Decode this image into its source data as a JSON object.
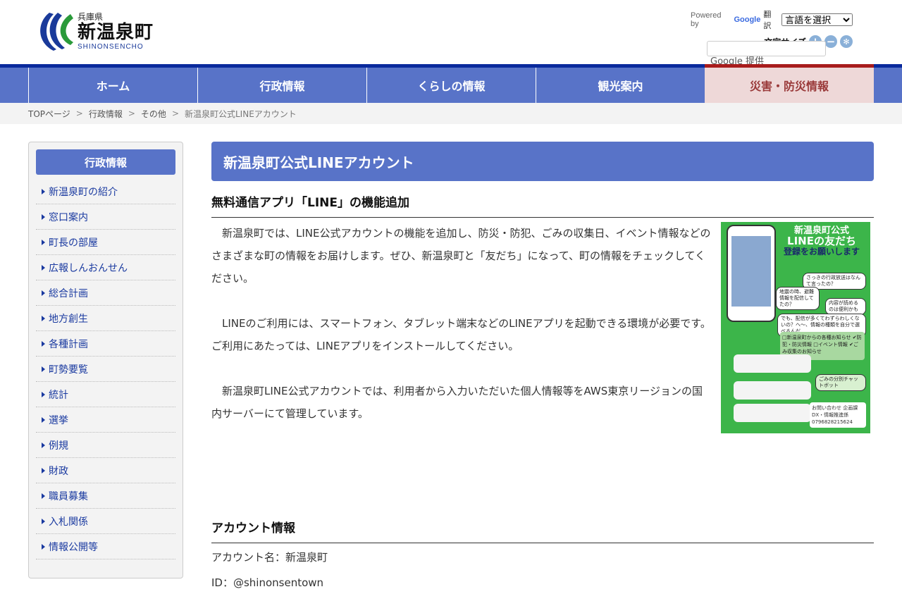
{
  "header": {
    "prefecture": "兵庫県",
    "town": "新温泉町",
    "romaji": "SHINONSENCHO",
    "powered_by": "Powered by",
    "google": "Google",
    "translate": "翻訳",
    "language_select": "言語を選択",
    "font_size_label": "文字サイズ",
    "google_provided": "Google 提供"
  },
  "nav": [
    "ホーム",
    "行政情報",
    "くらしの情報",
    "観光案内",
    "災害・防災情報"
  ],
  "breadcrumb": [
    "TOPページ",
    "行政情報",
    "その他",
    "新温泉町公式LINEアカウント"
  ],
  "breadcrumb_sep": ">",
  "sidebar": {
    "title": "行政情報",
    "items": [
      "新温泉町の紹介",
      "窓口案内",
      "町長の部屋",
      "広報しんおんせん",
      "総合計画",
      "地方創生",
      "各種計画",
      "町勢要覧",
      "統計",
      "選挙",
      "例規",
      "財政",
      "職員募集",
      "入札関係",
      "情報公開等"
    ]
  },
  "main": {
    "title": "新温泉町公式LINEアカウント",
    "section1": "無料通信アプリ「LINE」の機能追加",
    "paragraphs": [
      "新温泉町では、LINE公式アカウントの機能を追加し、防災・防犯、ごみの収集日、イベント情報などのさまざまな町の情報をお届けします。ぜひ、新温泉町と「友だち」になって、町の情報をチェックしてください。",
      "LINEのご利用には、スマートフォン、タブレット端末などのLINEアプリを起動できる環境が必要です。ご利用にあたっては、LINEアプリをインストールしてください。",
      "新温泉町LINE公式アカウントでは、利用者から入力いただいた個人情報等をAWS東京リージョンの国内サーバーにて管理しています。"
    ],
    "section2": "アカウント情報",
    "account_name": "アカウント名：新温泉町",
    "account_id": "ID：@shinonsentown"
  },
  "poster": {
    "line1": "新温泉町公式",
    "line2": "LINEの友だち",
    "line3": "登録をお願いします",
    "bubbles": [
      "さっきの行政放送はなんて言ったの？",
      "地震の時、避難情報を配信してたの？",
      "内容が読めるのは便利かも",
      "でも、配信が多くてわずらわしくないの？へ〜、情報の種類を自分で選べるんだ"
    ],
    "options": "□新温泉町からの各種お知らせ ✔防犯・防災情報 □イベント情報 ✔ごみ収集のお知らせ",
    "chatbot": "ごみの分別チャットボット",
    "contact": "お問い合わせ 企画課DX・情報推進係 0796828215624"
  }
}
